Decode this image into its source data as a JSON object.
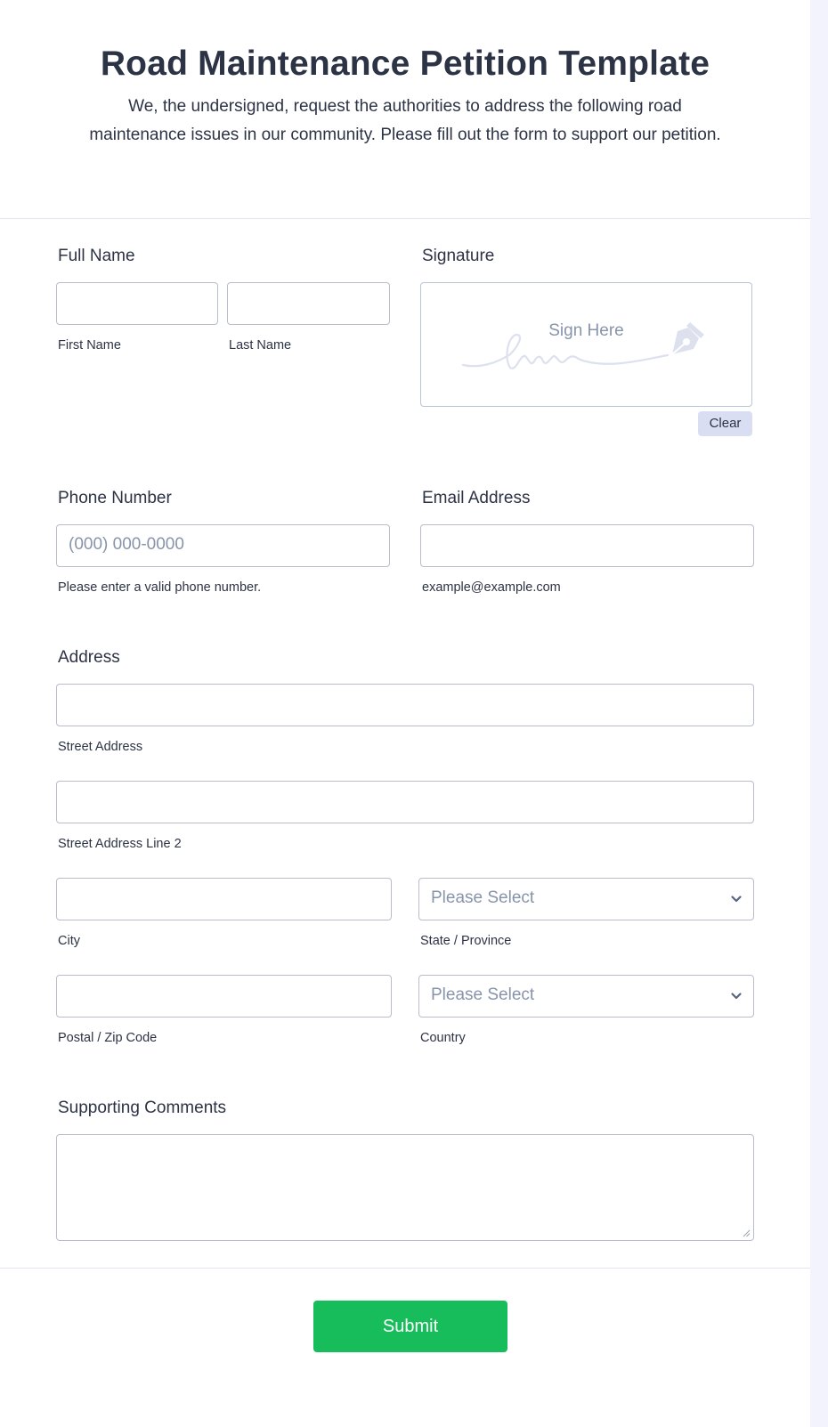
{
  "header": {
    "title": "Road Maintenance Petition Template",
    "subtitle": "We, the undersigned, request the authorities to address the following road maintenance issues in our community. Please fill out the form to support our petition."
  },
  "full_name": {
    "label": "Full Name",
    "first_sublabel": "First Name",
    "last_sublabel": "Last Name",
    "first_value": "",
    "last_value": ""
  },
  "signature": {
    "label": "Signature",
    "placeholder": "Sign Here",
    "icon": "pen-nib-icon",
    "clear_label": "Clear"
  },
  "phone": {
    "label": "Phone Number",
    "placeholder": "(000) 000-0000",
    "value": "",
    "sublabel": "Please enter a valid phone number."
  },
  "email": {
    "label": "Email Address",
    "value": "",
    "sublabel": "example@example.com"
  },
  "address": {
    "label": "Address",
    "street_sublabel": "Street Address",
    "street2_sublabel": "Street Address Line 2",
    "city_sublabel": "City",
    "state_sublabel": "State / Province",
    "state_selected": "Please Select",
    "zip_sublabel": "Postal / Zip Code",
    "country_sublabel": "Country",
    "country_selected": "Please Select"
  },
  "comments": {
    "label": "Supporting Comments",
    "value": ""
  },
  "submit": {
    "label": "Submit",
    "color": "#18bd5b"
  }
}
